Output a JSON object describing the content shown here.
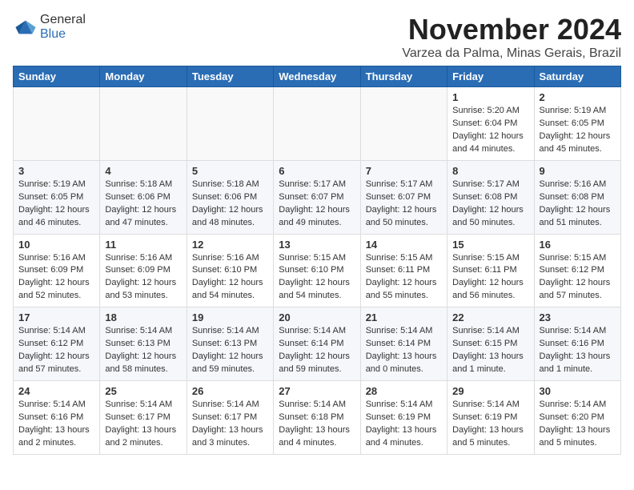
{
  "header": {
    "logo_line1": "General",
    "logo_line2": "Blue",
    "title": "November 2024",
    "subtitle": "Varzea da Palma, Minas Gerais, Brazil"
  },
  "calendar": {
    "headers": [
      "Sunday",
      "Monday",
      "Tuesday",
      "Wednesday",
      "Thursday",
      "Friday",
      "Saturday"
    ],
    "weeks": [
      [
        {
          "day": "",
          "info": ""
        },
        {
          "day": "",
          "info": ""
        },
        {
          "day": "",
          "info": ""
        },
        {
          "day": "",
          "info": ""
        },
        {
          "day": "",
          "info": ""
        },
        {
          "day": "1",
          "info": "Sunrise: 5:20 AM\nSunset: 6:04 PM\nDaylight: 12 hours and 44 minutes."
        },
        {
          "day": "2",
          "info": "Sunrise: 5:19 AM\nSunset: 6:05 PM\nDaylight: 12 hours and 45 minutes."
        }
      ],
      [
        {
          "day": "3",
          "info": "Sunrise: 5:19 AM\nSunset: 6:05 PM\nDaylight: 12 hours and 46 minutes."
        },
        {
          "day": "4",
          "info": "Sunrise: 5:18 AM\nSunset: 6:06 PM\nDaylight: 12 hours and 47 minutes."
        },
        {
          "day": "5",
          "info": "Sunrise: 5:18 AM\nSunset: 6:06 PM\nDaylight: 12 hours and 48 minutes."
        },
        {
          "day": "6",
          "info": "Sunrise: 5:17 AM\nSunset: 6:07 PM\nDaylight: 12 hours and 49 minutes."
        },
        {
          "day": "7",
          "info": "Sunrise: 5:17 AM\nSunset: 6:07 PM\nDaylight: 12 hours and 50 minutes."
        },
        {
          "day": "8",
          "info": "Sunrise: 5:17 AM\nSunset: 6:08 PM\nDaylight: 12 hours and 50 minutes."
        },
        {
          "day": "9",
          "info": "Sunrise: 5:16 AM\nSunset: 6:08 PM\nDaylight: 12 hours and 51 minutes."
        }
      ],
      [
        {
          "day": "10",
          "info": "Sunrise: 5:16 AM\nSunset: 6:09 PM\nDaylight: 12 hours and 52 minutes."
        },
        {
          "day": "11",
          "info": "Sunrise: 5:16 AM\nSunset: 6:09 PM\nDaylight: 12 hours and 53 minutes."
        },
        {
          "day": "12",
          "info": "Sunrise: 5:16 AM\nSunset: 6:10 PM\nDaylight: 12 hours and 54 minutes."
        },
        {
          "day": "13",
          "info": "Sunrise: 5:15 AM\nSunset: 6:10 PM\nDaylight: 12 hours and 54 minutes."
        },
        {
          "day": "14",
          "info": "Sunrise: 5:15 AM\nSunset: 6:11 PM\nDaylight: 12 hours and 55 minutes."
        },
        {
          "day": "15",
          "info": "Sunrise: 5:15 AM\nSunset: 6:11 PM\nDaylight: 12 hours and 56 minutes."
        },
        {
          "day": "16",
          "info": "Sunrise: 5:15 AM\nSunset: 6:12 PM\nDaylight: 12 hours and 57 minutes."
        }
      ],
      [
        {
          "day": "17",
          "info": "Sunrise: 5:14 AM\nSunset: 6:12 PM\nDaylight: 12 hours and 57 minutes."
        },
        {
          "day": "18",
          "info": "Sunrise: 5:14 AM\nSunset: 6:13 PM\nDaylight: 12 hours and 58 minutes."
        },
        {
          "day": "19",
          "info": "Sunrise: 5:14 AM\nSunset: 6:13 PM\nDaylight: 12 hours and 59 minutes."
        },
        {
          "day": "20",
          "info": "Sunrise: 5:14 AM\nSunset: 6:14 PM\nDaylight: 12 hours and 59 minutes."
        },
        {
          "day": "21",
          "info": "Sunrise: 5:14 AM\nSunset: 6:14 PM\nDaylight: 13 hours and 0 minutes."
        },
        {
          "day": "22",
          "info": "Sunrise: 5:14 AM\nSunset: 6:15 PM\nDaylight: 13 hours and 1 minute."
        },
        {
          "day": "23",
          "info": "Sunrise: 5:14 AM\nSunset: 6:16 PM\nDaylight: 13 hours and 1 minute."
        }
      ],
      [
        {
          "day": "24",
          "info": "Sunrise: 5:14 AM\nSunset: 6:16 PM\nDaylight: 13 hours and 2 minutes."
        },
        {
          "day": "25",
          "info": "Sunrise: 5:14 AM\nSunset: 6:17 PM\nDaylight: 13 hours and 2 minutes."
        },
        {
          "day": "26",
          "info": "Sunrise: 5:14 AM\nSunset: 6:17 PM\nDaylight: 13 hours and 3 minutes."
        },
        {
          "day": "27",
          "info": "Sunrise: 5:14 AM\nSunset: 6:18 PM\nDaylight: 13 hours and 4 minutes."
        },
        {
          "day": "28",
          "info": "Sunrise: 5:14 AM\nSunset: 6:19 PM\nDaylight: 13 hours and 4 minutes."
        },
        {
          "day": "29",
          "info": "Sunrise: 5:14 AM\nSunset: 6:19 PM\nDaylight: 13 hours and 5 minutes."
        },
        {
          "day": "30",
          "info": "Sunrise: 5:14 AM\nSunset: 6:20 PM\nDaylight: 13 hours and 5 minutes."
        }
      ]
    ]
  }
}
